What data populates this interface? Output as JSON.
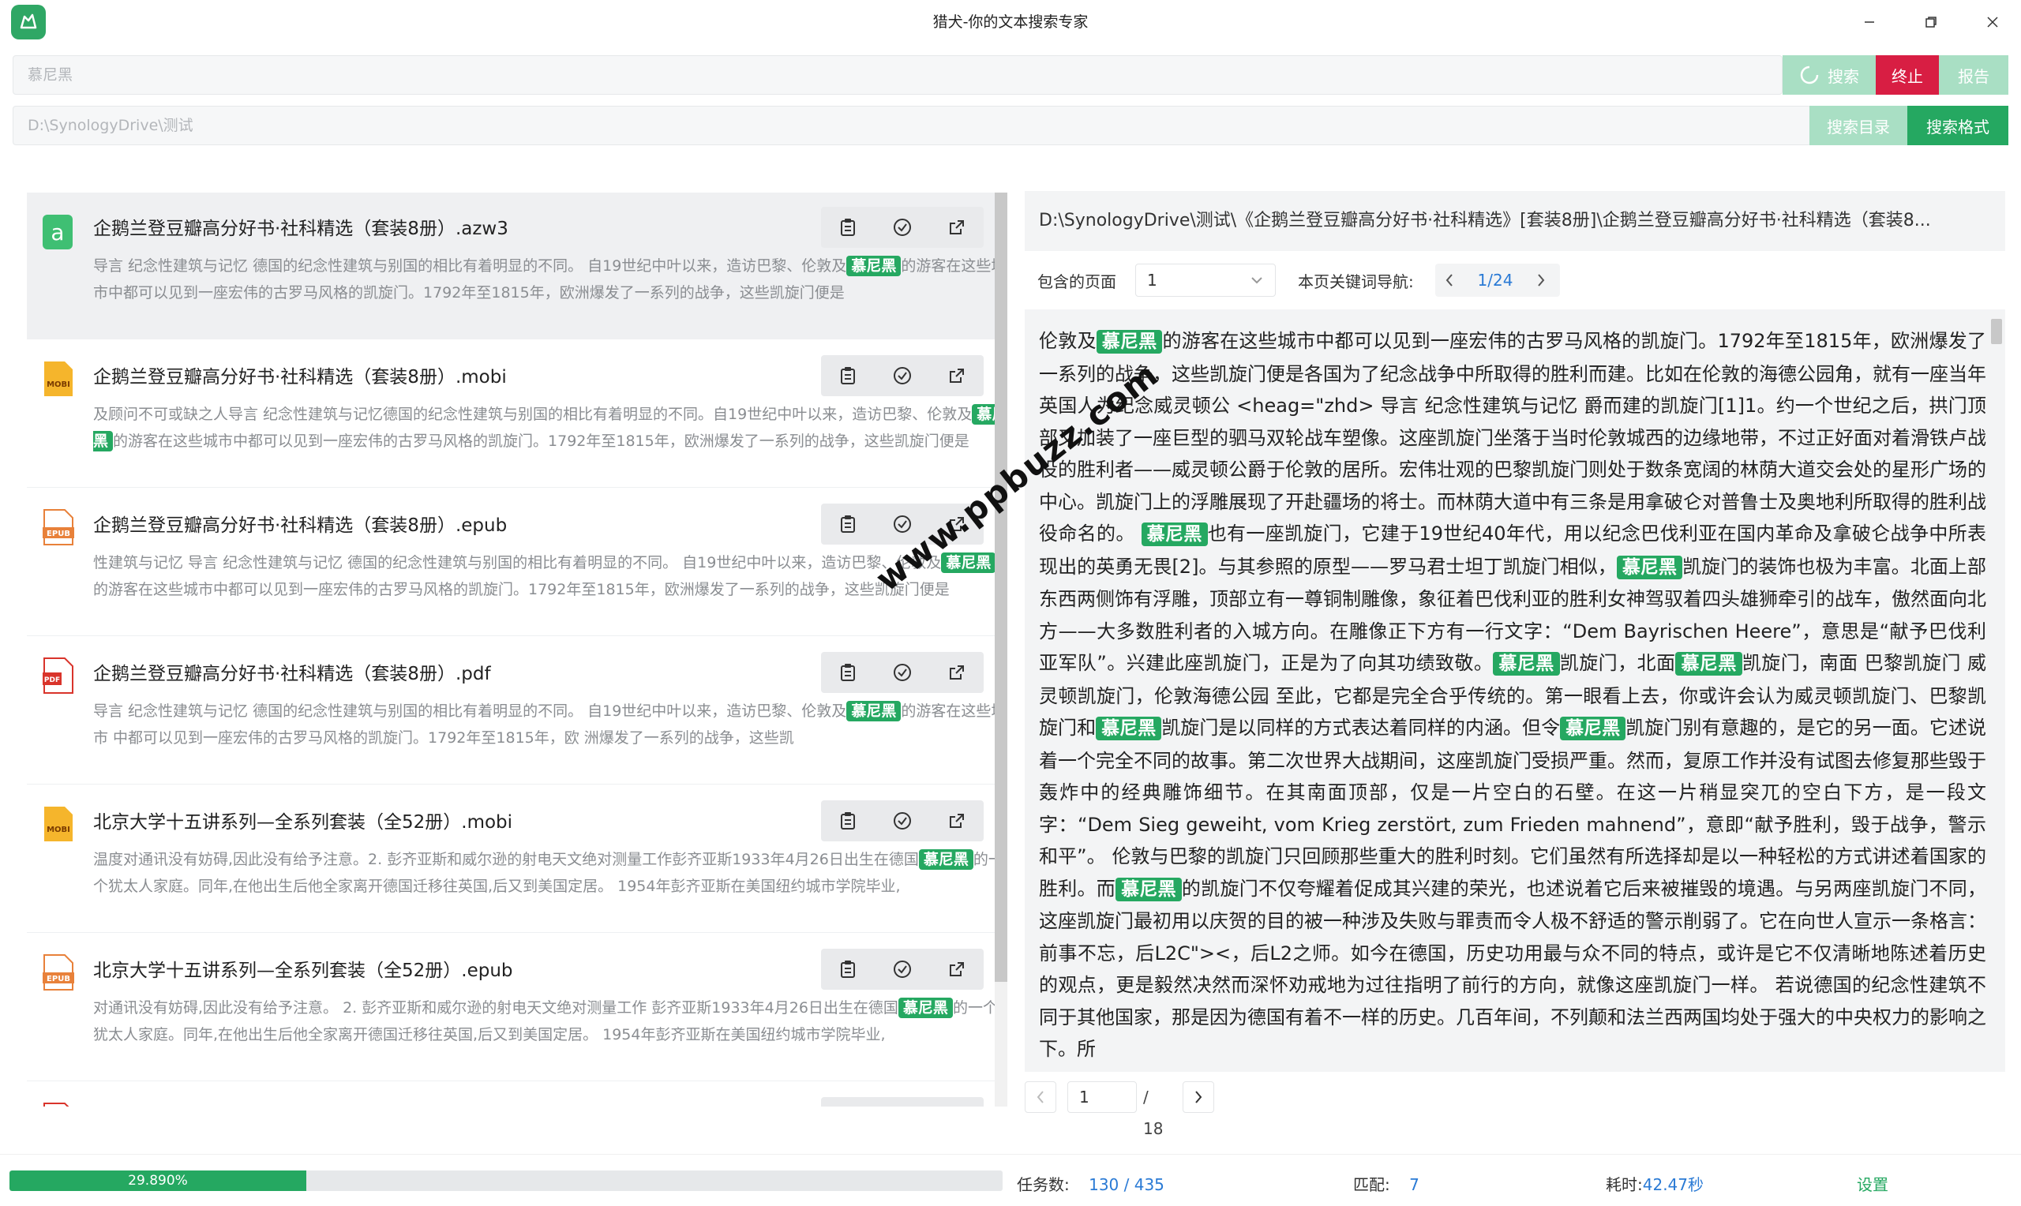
{
  "window": {
    "title": "猎犬-你的文本搜索专家",
    "controls": [
      "minimize-icon",
      "maximize-icon",
      "close-icon"
    ]
  },
  "search": {
    "query_placeholder": "慕尼黑",
    "search_button": "搜索",
    "stop_button": "终止",
    "report_button": "报告",
    "path_placeholder": "D:\\SynologyDrive\\测试",
    "dir_button": "搜索目录",
    "format_button": "搜索格式"
  },
  "colors": {
    "accent": "#25a861",
    "stop": "#d81e43",
    "highlight": "#25a861",
    "link": "#2a7ad5"
  },
  "results": [
    {
      "icon": "azw3-file-icon",
      "title": "企鹅兰登豆瓣高分好书·社科精选（套装8册）.azw3",
      "pre": "导言 纪念性建筑与记忆 德国的纪念性建筑与别国的相比有着明显的不同。 自19世纪中叶以来，造访巴黎、伦敦及",
      "kw": "慕尼黑",
      "post": "的游客在这些城市中都可以见到一座宏伟的古罗马风格的凯旋门。1792年至1815年，欧洲爆发了一系列的战争，这些凯旋门便是"
    },
    {
      "icon": "mobi-file-icon",
      "title": "企鹅兰登豆瓣高分好书·社科精选（套装8册）.mobi",
      "pre": "及顾问不可或缺之人导言 纪念性建筑与记忆德国的纪念性建筑与别国的相比有着明显的不同。自19世纪中叶以来，造访巴黎、伦敦及",
      "kw": "慕尼黑",
      "post": "的游客在这些城市中都可以见到一座宏伟的古罗马风格的凯旋门。1792年至1815年，欧洲爆发了一系列的战争，这些凯旋门便是"
    },
    {
      "icon": "epub-file-icon",
      "title": "企鹅兰登豆瓣高分好书·社科精选（套装8册）.epub",
      "pre": "性建筑与记忆 导言 纪念性建筑与记忆 德国的纪念性建筑与别国的相比有着明显的不同。 自19世纪中叶以来，造访巴黎、伦敦及",
      "kw": "慕尼黑",
      "post": "的游客在这些城市中都可以见到一座宏伟的古罗马风格的凯旋门。1792年至1815年，欧洲爆发了一系列的战争，这些凯旋门便是"
    },
    {
      "icon": "pdf-file-icon",
      "title": "企鹅兰登豆瓣高分好书·社科精选（套装8册）.pdf",
      "pre": "导言 纪念性建筑与记忆 德国的纪念性建筑与别国的相比有着明显的不同。 自19世纪中叶以来，造访巴黎、伦敦及",
      "kw": "慕尼黑",
      "post": "的游客在这些城市 中都可以见到一座宏伟的古罗马风格的凯旋门。1792年至1815年，欧 洲爆发了一系列的战争，这些凯"
    },
    {
      "icon": "mobi-file-icon",
      "title": "北京大学十五讲系列—全系列套装（全52册）.mobi",
      "pre": "温度对通讯没有妨碍,因此没有给予注意。2. 彭齐亚斯和威尔逊的射电天文绝对测量工作彭齐亚斯1933年4月26日出生在德国",
      "kw": "慕尼黑",
      "post": "的一个犹太人家庭。同年,在他出生后他全家离开德国迁移往英国,后又到美国定居。 1954年彭齐亚斯在美国纽约城市学院毕业,"
    },
    {
      "icon": "epub-file-icon",
      "title": "北京大学十五讲系列—全系列套装（全52册）.epub",
      "pre": "对通讯没有妨碍,因此没有给予注意。 2. 彭齐亚斯和威尔逊的射电天文绝对测量工作 彭齐亚斯1933年4月26日出生在德国",
      "kw": "慕尼黑",
      "post": "的一个犹太人家庭。同年,在他出生后他全家离开德国迁移往英国,后又到美国定居。 1954年彭齐亚斯在美国纽约城市学院毕业,"
    }
  ],
  "preview": {
    "path": "D:\\SynologyDrive\\测试\\《企鹅兰登豆瓣高分好书·社科精选》[套装8册]\\企鹅兰登豆瓣高分好书·社科精选（套装8...",
    "pages_label": "包含的页面",
    "pages_value": "1",
    "kw_nav_label": "本页关键词导航:",
    "kw_nav_value": "1/24",
    "content": [
      {
        "t": "伦敦及"
      },
      {
        "k": "慕尼黑"
      },
      {
        "t": "的游客在这些城市中都可以见到一座宏伟的古罗马风格的凯旋门。1792年至1815年，欧洲爆发了一系列的战争，这些凯旋门便是各国为了纪念战争中所取得的胜利而建。比如在伦敦的海德公园角，就有一座当年英国人为纪念威灵顿公 <heag=\"zhd> 导言 纪念性建筑与记忆 爵而建的凯旋门[1]1。约一个世纪之后，拱门顶部又加装了一座巨型的驷马双轮战车塑像。这座凯旋门坐落于当时伦敦城西的边缘地带，不过正好面对着滑铁卢战役的胜利者——威灵顿公爵于伦敦的居所。宏伟壮观的巴黎凯旋门则处于数条宽阔的林荫大道交会处的星形广场的中心。凯旋门上的浮雕展现了开赴疆场的将士。而林荫大道中有三条是用拿破仑对普鲁士及奥地利所取得的胜利战役命名的。 "
      },
      {
        "k": "慕尼黑"
      },
      {
        "t": "也有一座凯旋门，它建于19世纪40年代，用以纪念巴伐利亚在国内革命及拿破仑战争中所表现出的英勇无畏[2]。与其参照的原型——罗马君士坦丁凯旋门相似，"
      },
      {
        "k": "慕尼黑"
      },
      {
        "t": "凯旋门的装饰也极为丰富。北面上部东西两侧饰有浮雕，顶部立有一尊铜制雕像，象征着巴伐利亚的胜利女神驾驭着四头雄狮牵引的战车，傲然面向北方——大多数胜利者的入城方向。在雕像正下方有一行文字：“Dem Bayrischen Heere”，意思是“献予巴伐利亚军队”。兴建此座凯旋门，正是为了向其功绩致敬。"
      },
      {
        "k": "慕尼黑"
      },
      {
        "t": "凯旋门，北面"
      },
      {
        "k": "慕尼黑"
      },
      {
        "t": "凯旋门，南面 巴黎凯旋门 威灵顿凯旋门，伦敦海德公园 至此，它都是完全合乎传统的。第一眼看上去，你或许会认为威灵顿凯旋门、巴黎凯旋门和"
      },
      {
        "k": "慕尼黑"
      },
      {
        "t": "凯旋门是以同样的方式表达着同样的内涵。但令"
      },
      {
        "k": "慕尼黑"
      },
      {
        "t": "凯旋门别有意趣的，是它的另一面。它述说着一个完全不同的故事。第二次世界大战期间，这座凯旋门受损严重。然而，复原工作并没有试图去修复那些毁于轰炸中的经典雕饰细节。在其南面顶部，仅是一片空白的石壁。在这一片稍显突兀的空白下方，是一段文字：“Dem Sieg geweiht, vom Krieg zerstört, zum Frieden mahnend”，意即“献予胜利，毁于战争，警示和平”。 伦敦与巴黎的凯旋门只回顾那些重大的胜利时刻。它们虽然有所选择却是以一种轻松的方式讲述着国家的胜利。而"
      },
      {
        "k": "慕尼黑"
      },
      {
        "t": "的凯旋门不仅夸耀着促成其兴建的荣光，也述说着它后来被摧毁的境遇。与另两座凯旋门不同，这座凯旋门最初用以庆贺的目的被一种涉及失败与罪责而令人极不舒适的警示削弱了。它在向世人宣示一条格言：前事不忘，后L2C\"><，后L2之师。如今在德国，历史功用最与众不同的特点，或许是它不仅清晰地陈述着历史的观点，更是毅然决然而深怀劝戒地为过往指明了前行的方向，就像这座凯旋门一样。 若说德国的纪念性建筑不同于其他国家，那是因为德国有着不一样的历史。几百年间，不列颠和法兰西两国均处于强大的中央权力的影响之下。所"
      }
    ],
    "pager_value": "1",
    "pager_total": "/ 18"
  },
  "status": {
    "progress": 0.2989,
    "progress_label": "29.890%",
    "tasks_label": "任务数:",
    "tasks_value": "130 / 435",
    "match_label": "匹配:",
    "match_value": "7",
    "elapsed_label": "耗时:",
    "elapsed_value": "42.47秒",
    "settings_label": "设置"
  },
  "watermark": "www.ppbuzz.com"
}
